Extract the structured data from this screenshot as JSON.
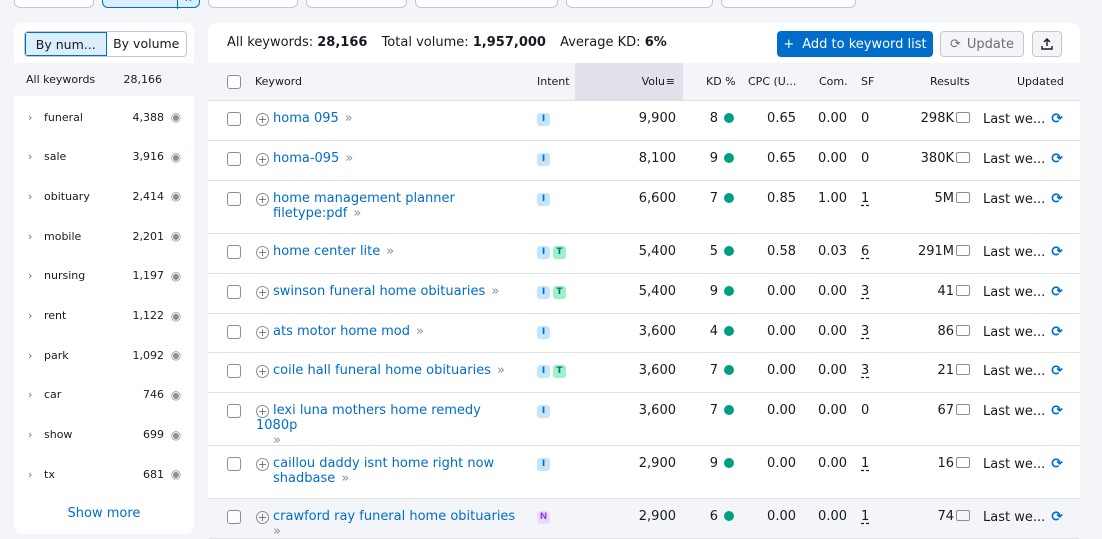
{
  "left_panel": {
    "toggle": [
      "By num...",
      "By volume"
    ],
    "header": {
      "label": "All keywords",
      "count": "28,166"
    },
    "groups": [
      {
        "name": "funeral",
        "count": "4,388"
      },
      {
        "name": "sale",
        "count": "3,916"
      },
      {
        "name": "obituary",
        "count": "2,414"
      },
      {
        "name": "mobile",
        "count": "2,201"
      },
      {
        "name": "nursing",
        "count": "1,197"
      },
      {
        "name": "rent",
        "count": "1,122"
      },
      {
        "name": "park",
        "count": "1,092"
      },
      {
        "name": "car",
        "count": "746"
      },
      {
        "name": "show",
        "count": "699"
      },
      {
        "name": "tx",
        "count": "681"
      }
    ],
    "show_more": "Show more"
  },
  "summary": {
    "all_keywords_label": "All keywords:",
    "all_keywords_value": "28,166",
    "total_volume_label": "Total volume:",
    "total_volume_value": "1,957,000",
    "avg_kd_label": "Average KD:",
    "avg_kd_value": "6%"
  },
  "buttons": {
    "add": "Add to keyword list",
    "update": "Update"
  },
  "columns": {
    "keyword": "Keyword",
    "intent": "Intent",
    "volume": "Volu",
    "kd": "KD %",
    "cpc": "CPC (U...",
    "com": "Com.",
    "sf": "SF",
    "results": "Results",
    "updated": "Updated"
  },
  "rows": [
    {
      "keyword": [
        "homa 095"
      ],
      "intent": [
        "I"
      ],
      "volume": "9,900",
      "kd": "8",
      "cpc": "0.65",
      "com": "0.00",
      "sf": "0",
      "sf_link": false,
      "results": "298K",
      "updated": "Last we..."
    },
    {
      "keyword": [
        "homa-095"
      ],
      "intent": [
        "I"
      ],
      "volume": "8,100",
      "kd": "9",
      "cpc": "0.65",
      "com": "0.00",
      "sf": "0",
      "sf_link": false,
      "results": "380K",
      "updated": "Last we..."
    },
    {
      "keyword": [
        "home management planner",
        "filetype:pdf"
      ],
      "intent": [
        "I"
      ],
      "volume": "6,600",
      "kd": "7",
      "cpc": "0.85",
      "com": "1.00",
      "sf": "1",
      "sf_link": true,
      "results": "5M",
      "updated": "Last we..."
    },
    {
      "keyword": [
        "home center lite"
      ],
      "intent": [
        "I",
        "T"
      ],
      "volume": "5,400",
      "kd": "5",
      "cpc": "0.58",
      "com": "0.03",
      "sf": "6",
      "sf_link": true,
      "results": "291M",
      "updated": "Last we..."
    },
    {
      "keyword": [
        "swinson funeral home obituaries"
      ],
      "intent": [
        "I",
        "T"
      ],
      "volume": "5,400",
      "kd": "9",
      "cpc": "0.00",
      "com": "0.00",
      "sf": "3",
      "sf_link": true,
      "results": "41",
      "updated": "Last we..."
    },
    {
      "keyword": [
        "ats motor home mod"
      ],
      "intent": [
        "I"
      ],
      "volume": "3,600",
      "kd": "4",
      "cpc": "0.00",
      "com": "0.00",
      "sf": "3",
      "sf_link": true,
      "results": "86",
      "updated": "Last we..."
    },
    {
      "keyword": [
        "coile hall funeral home obituaries"
      ],
      "intent": [
        "I",
        "T"
      ],
      "volume": "3,600",
      "kd": "7",
      "cpc": "0.00",
      "com": "0.00",
      "sf": "3",
      "sf_link": true,
      "results": "21",
      "updated": "Last we..."
    },
    {
      "keyword": [
        "lexi luna mothers home remedy 1080p",
        ""
      ],
      "intent": [
        "I"
      ],
      "volume": "3,600",
      "kd": "7",
      "cpc": "0.00",
      "com": "0.00",
      "sf": "0",
      "sf_link": false,
      "results": "67",
      "updated": "Last we..."
    },
    {
      "keyword": [
        "caillou daddy isnt home right now",
        "shadbase"
      ],
      "intent": [
        "I"
      ],
      "volume": "2,900",
      "kd": "9",
      "cpc": "0.00",
      "com": "0.00",
      "sf": "1",
      "sf_link": true,
      "results": "16",
      "updated": "Last we..."
    },
    {
      "keyword": [
        "crawford ray funeral home obituaries",
        ""
      ],
      "intent": [
        "N"
      ],
      "volume": "2,900",
      "kd": "6",
      "cpc": "0.00",
      "com": "0.00",
      "sf": "1",
      "sf_link": true,
      "results": "74",
      "updated": "Last we..."
    }
  ],
  "colors": {
    "accent": "#006dca",
    "kd_dot": "#009f81",
    "intent_I": "#c4e5fe",
    "intent_T": "#9ef2c9",
    "intent_N": "#edd9ff"
  },
  "icons": {
    "group_chevron": "chevron-right-icon",
    "visibility": "eye-icon",
    "add_keyword": "plus-circle-icon",
    "more": "double-chevron-right-icon",
    "serp": "serp-preview-icon",
    "refresh": "refresh-icon",
    "export": "export-icon"
  }
}
